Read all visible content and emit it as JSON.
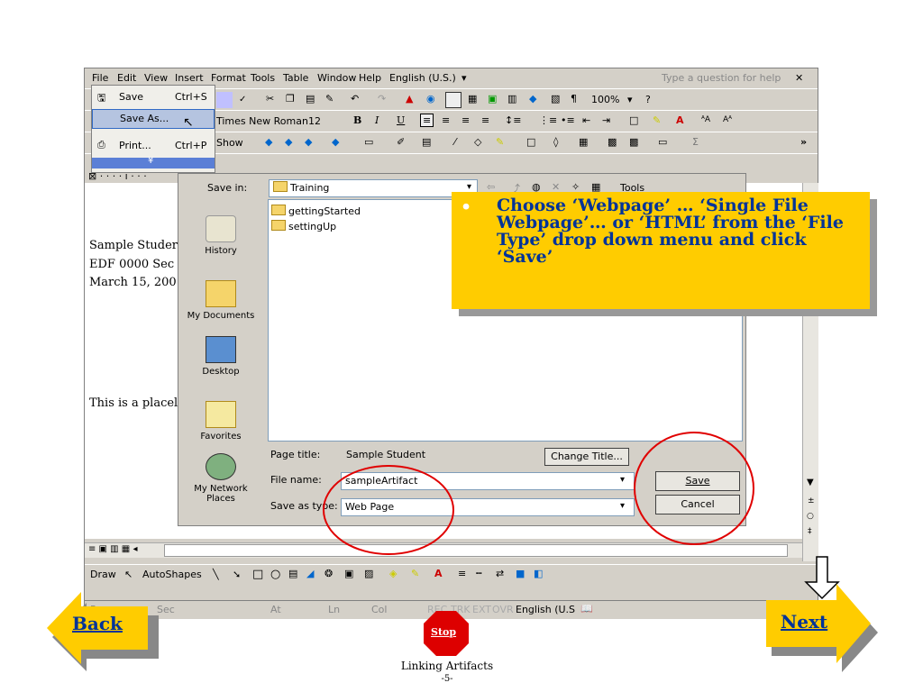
{
  "menubar": {
    "items": [
      "File",
      "Edit",
      "View",
      "Insert",
      "Format",
      "Tools",
      "Table",
      "Window",
      "Help"
    ],
    "language": "English (U.S.)",
    "help_placeholder": "Type a question for help"
  },
  "toolbar": {
    "zoom": "100%",
    "font": "Times New Roman",
    "font_size": "12",
    "show_label": "Show"
  },
  "file_menu": {
    "save": "Save",
    "save_shortcut": "Ctrl+S",
    "save_as": "Save As...",
    "print": "Print...",
    "print_shortcut": "Ctrl+P"
  },
  "document": {
    "lines": [
      "Sample Studer",
      "EDF 0000 Sec",
      "March 15, 200"
    ],
    "placeholder": "This is a placel"
  },
  "dialog": {
    "save_in_label": "Save in:",
    "save_in_value": "Training",
    "tools_label": "Tools",
    "places": [
      "History",
      "My Documents",
      "Desktop",
      "Favorites",
      "My Network Places"
    ],
    "files": [
      "gettingStarted",
      "settingUp"
    ],
    "page_title_label": "Page title:",
    "page_title_value": "Sample Student",
    "change_title": "Change Title...",
    "file_name_label": "File name:",
    "file_name_value": "sampleArtifact",
    "save_type_label": "Save as type:",
    "save_type_value": "Web Page",
    "save_button": "Save",
    "cancel_button": "Cancel"
  },
  "callout": {
    "bullet": "•",
    "text": "Choose ‘Webpage’ … ‘Single File Webpage’… or ‘HTML’ from the ‘File Type’ drop down menu and click ‘Save’"
  },
  "drawing_toolbar": {
    "draw": "Draw",
    "autoshapes": "AutoShapes"
  },
  "statusbar": {
    "items": [
      "Page",
      "Sec",
      "At",
      "Ln",
      "Col",
      "REC",
      "TRK",
      "EXT",
      "OVR",
      "English (U.S"
    ]
  },
  "nav": {
    "back": "Back",
    "next": "Next",
    "stop": "Stop"
  },
  "footer": {
    "title": "Linking Artifacts",
    "page": "-5-"
  },
  "colors": {
    "callout_bg": "#ffcc00",
    "callout_text": "#003399",
    "arrow_fill": "#ffcc00",
    "circle": "#e00000",
    "stop": "#dd0000"
  }
}
